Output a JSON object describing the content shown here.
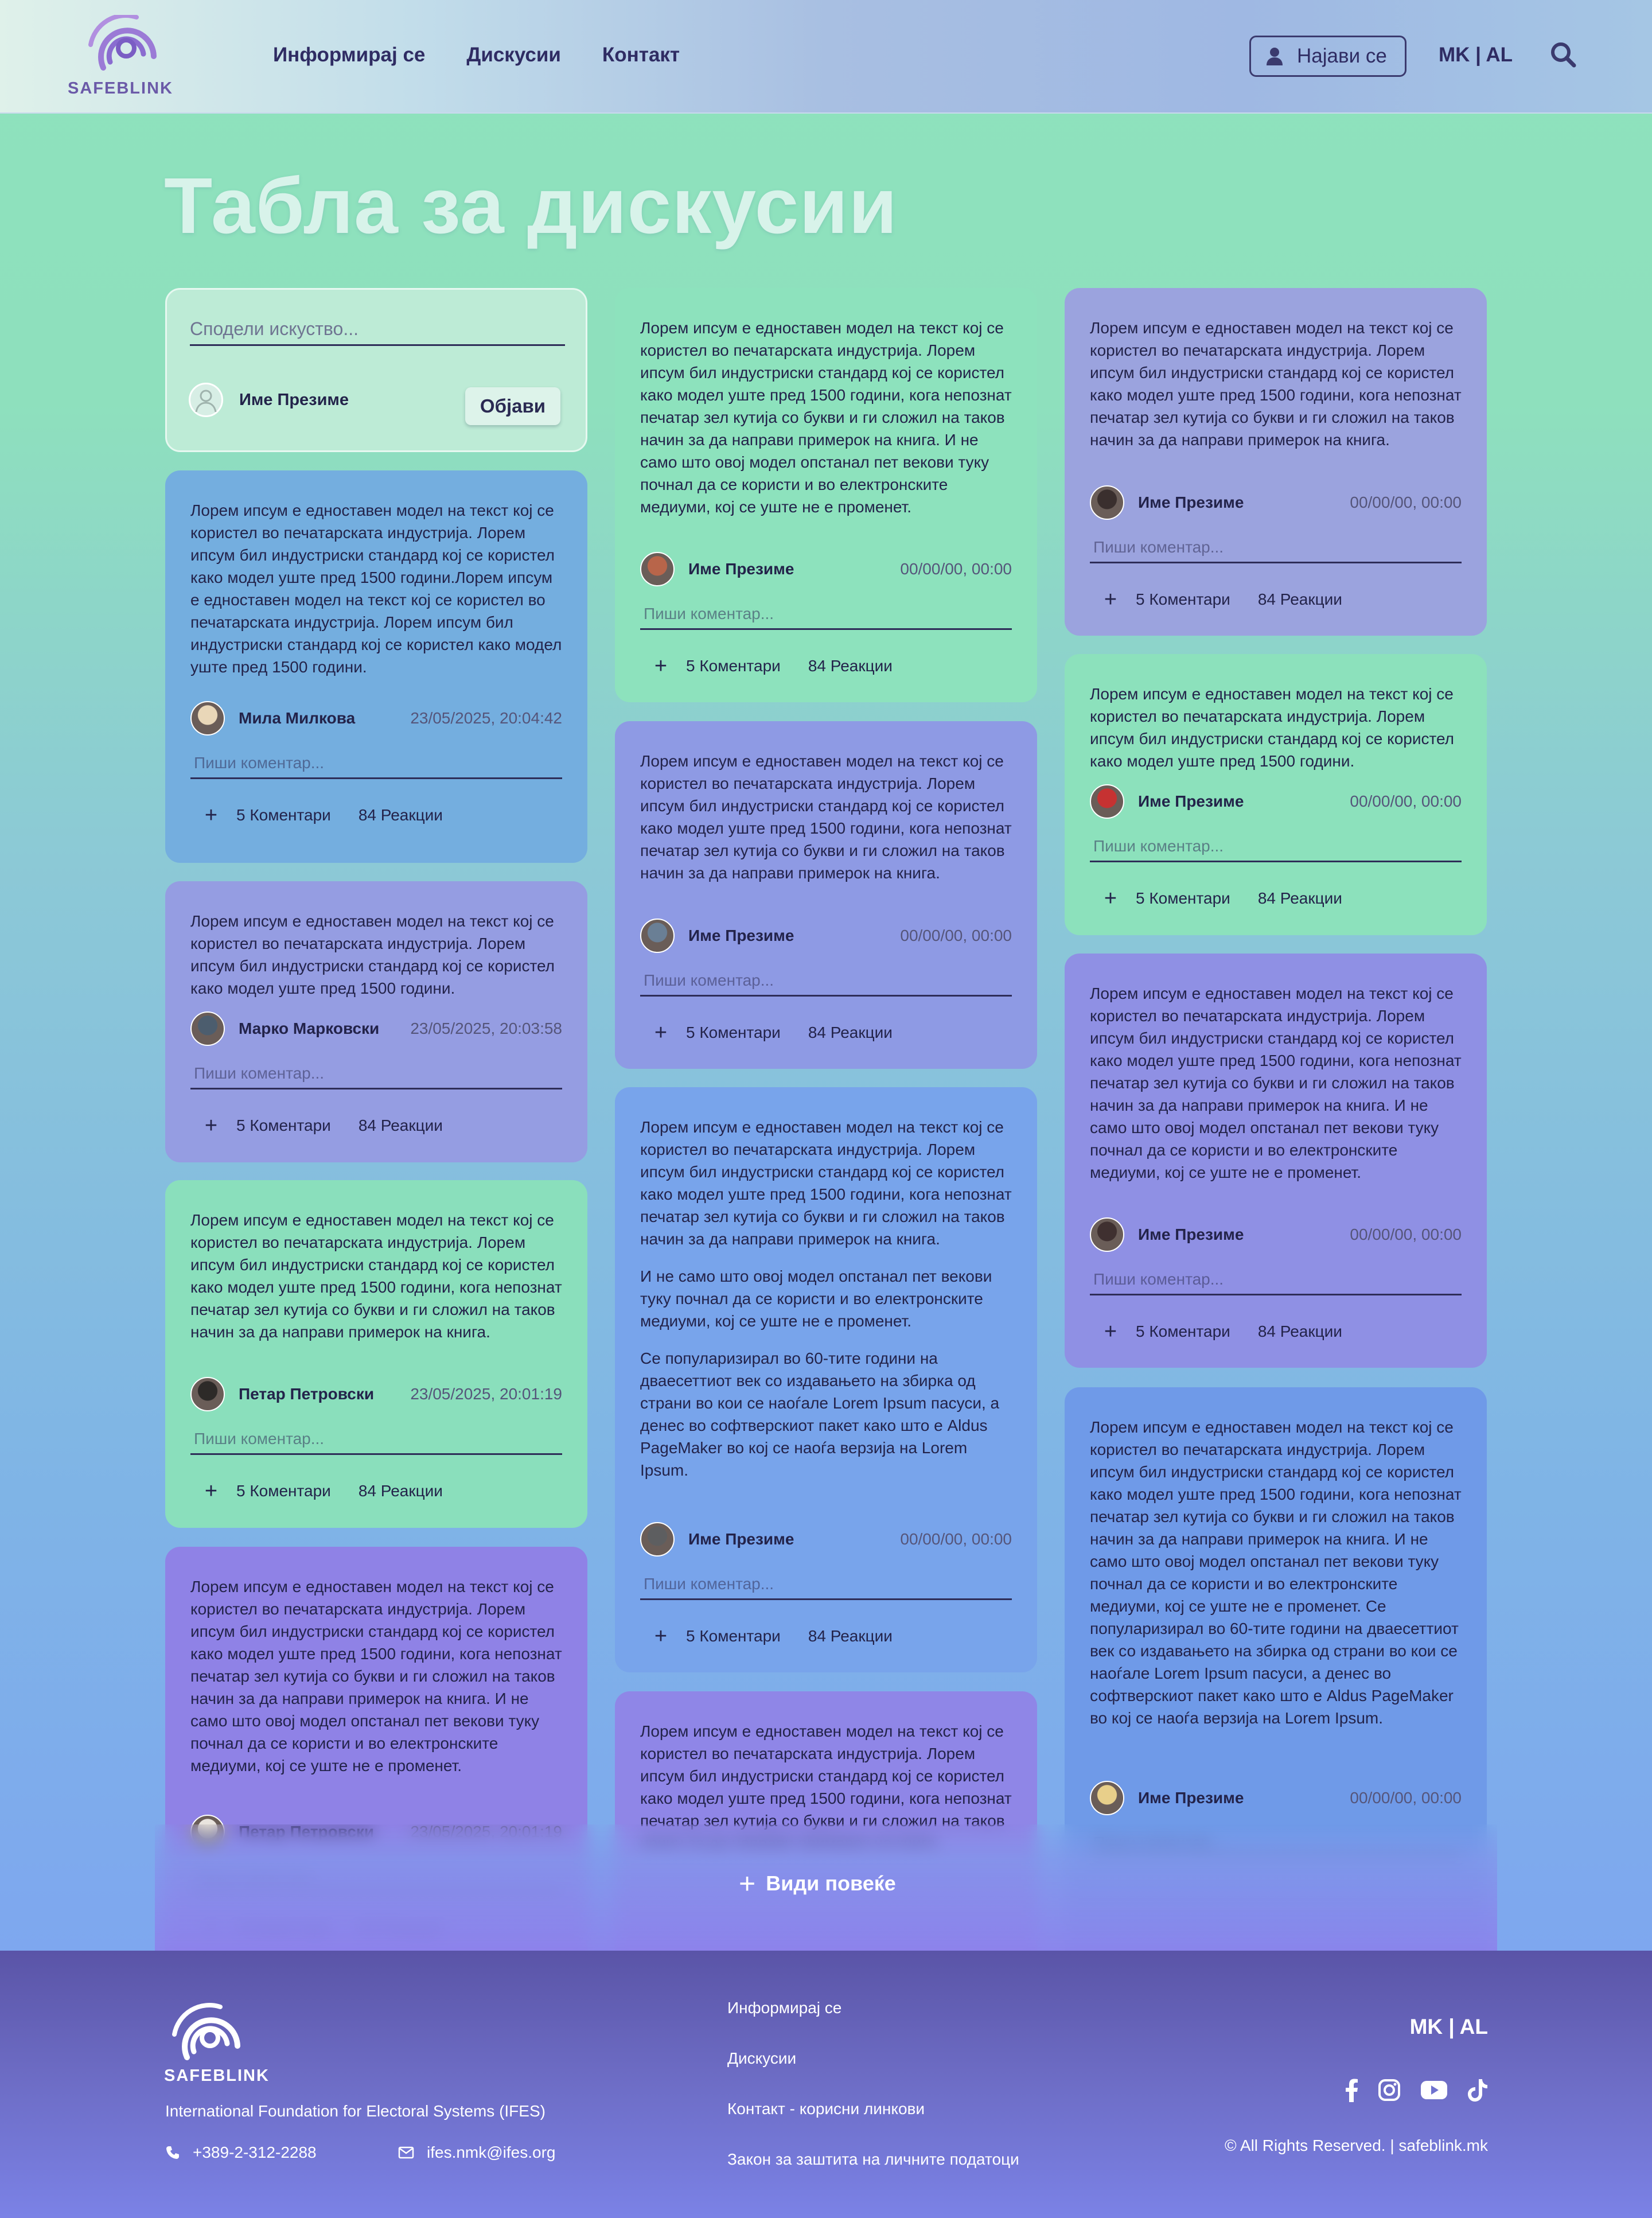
{
  "header": {
    "logo_text": "SAFEBLINK",
    "nav": [
      "Информирај се",
      "Дискусии",
      "Контакт"
    ],
    "login_label": "Најави се",
    "language": "MK | AL"
  },
  "page": {
    "title": "Табла за дискусии"
  },
  "composer": {
    "placeholder": "Сподели искуство...",
    "user_name": "Име Презиме",
    "publish_label": "Објави"
  },
  "comment_placeholder": "Пиши коментар...",
  "posts": [
    {
      "paragraphs": [
        "Лорем ипсум е едноставен модел на текст кој се користел во печатарската индустрија. Лорем ипсум бил индустриски стандард кој се користел како модел уште пред 1500 години.Лорем ипсум е едноставен модел на текст кој се користел во печатарската индустрија. Лорем ипсум бил индустриски стандард кој се користел како модел уште пред 1500 години."
      ],
      "author": "Мила Милкова",
      "date": "23/05/2025, 20:04:42",
      "comments_label": "5 Коментари",
      "reactions_label": "84 Реакции",
      "color": "#74aedf"
    },
    {
      "paragraphs": [
        "Лорем ипсум е едноставен модел на текст кој се користел во печатарската индустрија. Лорем ипсум бил индустриски стандард кој се користел како модел уште пред 1500 години."
      ],
      "author": "Марко Марковски",
      "date": "23/05/2025, 20:03:58",
      "comments_label": "5 Коментари",
      "reactions_label": "84 Реакции",
      "color": "#959de2"
    },
    {
      "paragraphs": [
        "Лорем ипсум е едноставен модел на текст кој се користел во печатарската индустрија. Лорем ипсум бил индустриски стандард кој се користел како модел уште пред 1500 години, кога непознат печатар зел кутија со букви и ги сложил на таков начин за да направи примерок на книга."
      ],
      "author": "Петар Петровски",
      "date": "23/05/2025, 20:01:19",
      "comments_label": "5 Коментари",
      "reactions_label": "84 Реакции",
      "color": "#8adfbc"
    },
    {
      "paragraphs": [
        "Лорем ипсум е едноставен модел на текст кој се користел во печатарската индустрија. Лорем ипсум бил индустриски стандард кој се користел како модел уште пред 1500 години, кога непознат печатар зел кутија со букви и ги сложил на таков начин за да направи примерок на книга. И не само што овој модел опстанал пет векови туку почнал да се користи и во електронските медиуми, кој се уште не е променет."
      ],
      "author": "Петар Петровски",
      "date": "23/05/2025, 20:01:19",
      "comments_label": "5 Коментари",
      "reactions_label": "84 Реакции",
      "color": "#8f82e6"
    },
    {
      "paragraphs": [
        "Лорем ипсум е едноставен модел на текст кој се користел во печатарската индустрија. Лорем ипсум бил индустриски стандард кој се користел како модел уште пред 1500 години, кога непознат печатар зел кутија со букви и ги сложил на таков начин за да направи примерок на книга. И не само што овој модел опстанал пет векови туку почнал да се користи и во електронските медиуми, кој се уште не е променет."
      ],
      "author": "Име Презиме",
      "date": "00/00/00, 00:00",
      "comments_label": "5 Коментари",
      "reactions_label": "84 Реакции",
      "color": "#8de2bd"
    },
    {
      "paragraphs": [
        "Лорем ипсум е едноставен модел на текст кој се користел во печатарската индустрија. Лорем ипсум бил индустриски стандард кој се користел како модел уште пред 1500 години, кога непознат печатар зел кутија со букви и ги сложил на таков начин за да направи примерок на книга."
      ],
      "author": "Име Презиме",
      "date": "00/00/00, 00:00",
      "comments_label": "5 Коментари",
      "reactions_label": "84 Реакции",
      "color": "#8e9ae4"
    },
    {
      "paragraphs": [
        "Лорем ипсум е едноставен модел на текст кој се користел во печатарската индустрија. Лорем ипсум бил индустриски стандард кој се користел како модел уште пред 1500 години, кога непознат печатар зел кутија со букви и ги сложил на таков начин за да направи примерок на книга.",
        "И не само што овој модел опстанал пет векови туку почнал да се користи и во електронските медиуми, кој се уште не е променет.",
        "Се популаризирал во 60-тите години на дваесеттиот век со издавањето на збирка од страни во кои се наоѓале Lorem Ipsum пасуси, а денес во софтверскиот пакет како што е Aldus PageMaker во кој се наоѓа верзија на Lorem Ipsum."
      ],
      "author": "Име Презиме",
      "date": "00/00/00, 00:00",
      "comments_label": "5 Коментари",
      "reactions_label": "84 Реакции",
      "color": "#78a4eb"
    },
    {
      "paragraphs": [
        "Лорем ипсум е едноставен модел на текст кој се користел во печатарската индустрија. Лорем ипсум бил индустриски стандард кој се користел како модел уште пред 1500 години, кога непознат печатар зел кутија со букви и ги сложил на таков начин за да направи примерок на книга."
      ],
      "author": "",
      "date": "",
      "comments_label": "",
      "reactions_label": "",
      "color": "#8f86e7"
    },
    {
      "paragraphs": [
        "Лорем ипсум е едноставен модел на текст кој се користел во печатарската индустрија. Лорем ипсум бил индустриски стандард кој се користел како модел уште пред 1500 години, кога непознат печатар зел кутија со букви и ги сложил на таков начин за да направи примерок на книга."
      ],
      "author": "Име Презиме",
      "date": "00/00/00, 00:00",
      "comments_label": "5 Коментари",
      "reactions_label": "84 Реакции",
      "color": "#9ba3de"
    },
    {
      "paragraphs": [
        "Лорем ипсум е едноставен модел на текст кој се користел во печатарската индустрија. Лорем ипсум бил индустриски стандард кој се користел како модел уште пред 1500 години."
      ],
      "author": "Име Презиме",
      "date": "00/00/00, 00:00",
      "comments_label": "5 Коментари",
      "reactions_label": "84 Реакции",
      "color": "#8ce1bc"
    },
    {
      "paragraphs": [
        "Лорем ипсум е едноставен модел на текст кој се користел во печатарската индустрија. Лорем ипсум бил индустриски стандард кој се користел како модел уште пред 1500 години, кога непознат печатар зел кутија со букви и ги сложил на таков начин за да направи примерок на книга. И не само што овој модел опстанал пет векови туку почнал да се користи и во електронските медиуми, кој се уште не е променет."
      ],
      "author": "Име Презиме",
      "date": "00/00/00, 00:00",
      "comments_label": "5 Коментари",
      "reactions_label": "84 Реакции",
      "color": "#8f90e4"
    },
    {
      "paragraphs": [
        "Лорем ипсум е едноставен модел на текст кој се користел во печатарската индустрија. Лорем ипсум бил индустриски стандард кој се користел како модел уште пред 1500 години, кога непознат печатар зел кутија со букви и ги сложил на таков начин за да направи примерок на книга. И не само што овој модел опстанал пет векови туку почнал да се користи и во електронските медиуми, кој се уште не е променет. Се популаризирал во 60-тите години на дваесеттиот век со издавањето на збирка од страни во кои се наоѓале Lorem Ipsum пасуси, а денес во софтверскиот пакет како што е Aldus PageMaker во кој се наоѓа верзија на Lorem Ipsum."
      ],
      "author": "Име Презиме",
      "date": "00/00/00, 00:00",
      "comments_label": "",
      "reactions_label": "",
      "color": "#6f9ae8"
    }
  ],
  "see_more_label": "Види повеќе",
  "footer": {
    "logo_text": "SAFEBLINK",
    "org": "International Foundation for Electoral Systems (IFES)",
    "phone": "+389-2-312-2288",
    "email": "ifes.nmk@ifes.org",
    "links": [
      "Информирај се",
      "Дискусии",
      "Контакт - корисни линкови",
      "Закон за заштита на личните податоци"
    ],
    "language": "MK | AL",
    "social": [
      "facebook-icon",
      "instagram-icon",
      "youtube-icon",
      "tiktok-icon"
    ],
    "copyright": "© All Rights Reserved. | safeblink.mk"
  }
}
